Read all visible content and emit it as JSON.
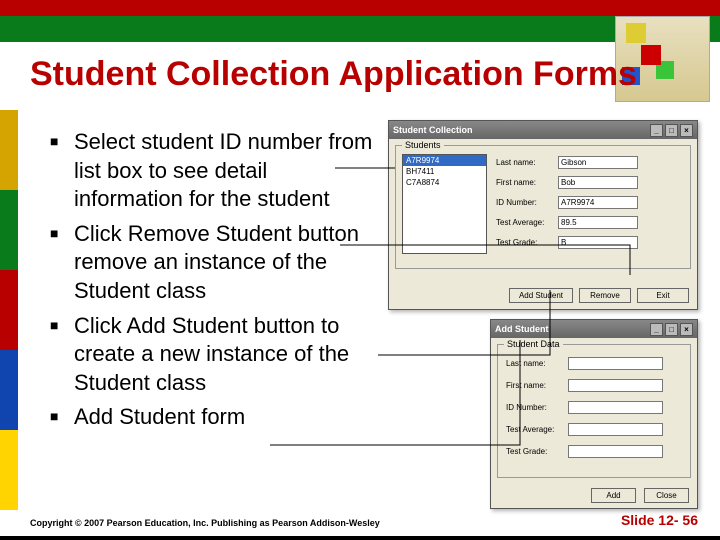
{
  "title": "Student Collection Application Forms",
  "bullets": [
    "Select student ID number from list box to see detail information for the student",
    "Click Remove Student button remove an instance of the Student class",
    "Click Add Student button to create a new instance of the Student class",
    "Add Student form"
  ],
  "win1": {
    "title": "Student Collection",
    "group": "Students",
    "list": [
      "A7R9974",
      "BH7411",
      "C7A8874"
    ],
    "fields": {
      "lastname_label": "Last name:",
      "lastname_val": "Gibson",
      "firstname_label": "First name:",
      "firstname_val": "Bob",
      "id_label": "ID Number:",
      "id_val": "A7R9974",
      "avg_label": "Test Average:",
      "avg_val": "89.5",
      "grade_label": "Test Grade:",
      "grade_val": "B"
    },
    "buttons": {
      "add": "Add Student",
      "remove": "Remove",
      "exit": "Exit"
    }
  },
  "win2": {
    "title": "Add Student",
    "group": "Student Data",
    "fields": {
      "lastname_label": "Last name:",
      "firstname_label": "First name:",
      "id_label": "ID Number:",
      "avg_label": "Test Average:",
      "grade_label": "Test Grade:"
    },
    "buttons": {
      "add": "Add",
      "close": "Close"
    }
  },
  "footer": {
    "copyright": "Copyright © 2007 Pearson Education, Inc. Publishing as Pearson Addison-Wesley",
    "slide": "Slide 12- 56"
  }
}
